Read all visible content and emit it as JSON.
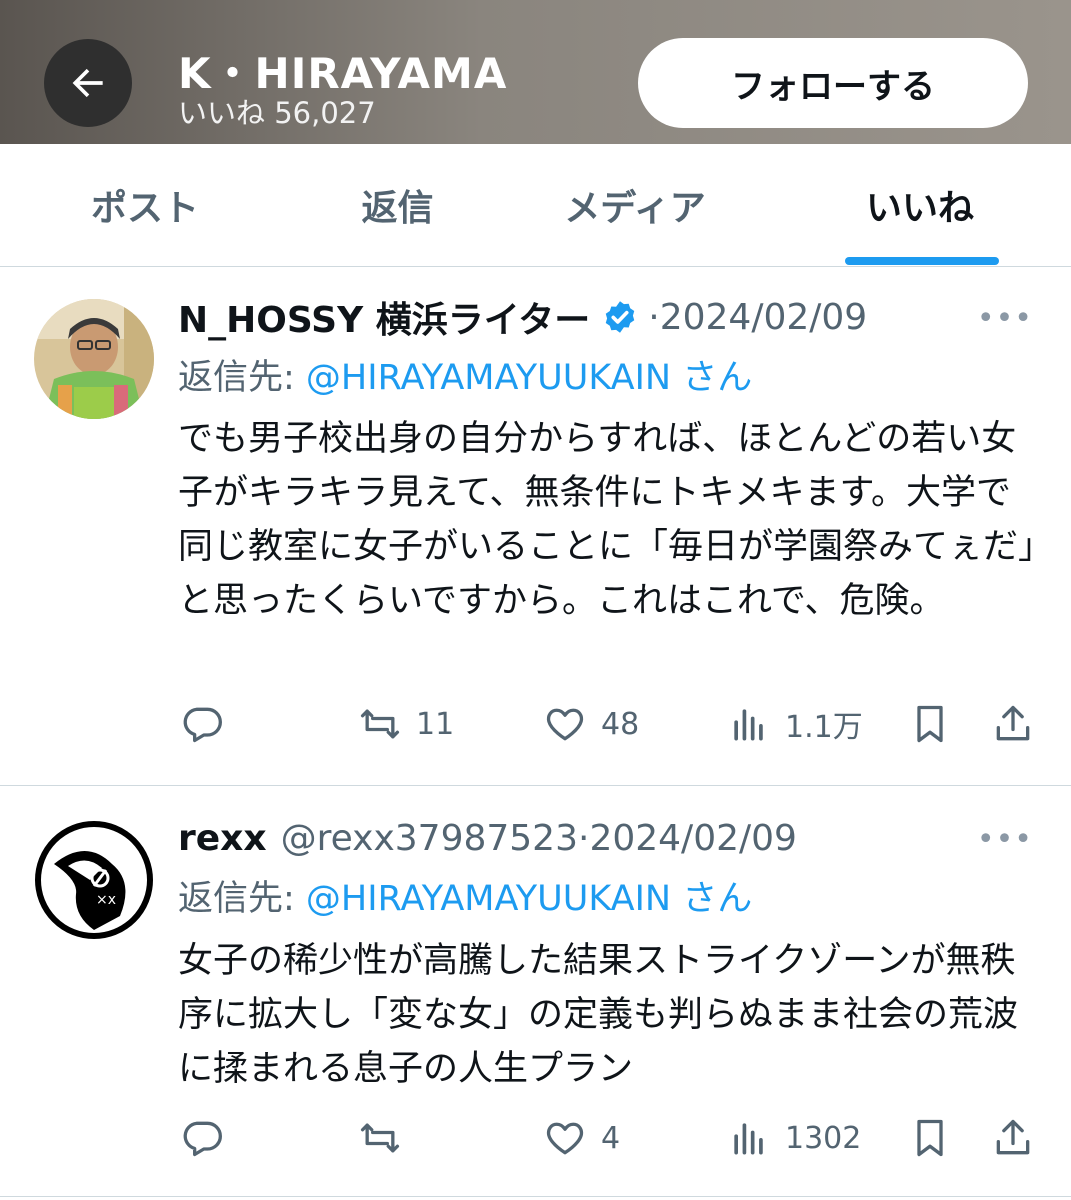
{
  "header": {
    "profile_name": "K・HIRAYAMA",
    "likes_label": "いいね 56,027",
    "follow_label": "フォローする"
  },
  "tabs": [
    {
      "label": "ポスト",
      "active": false
    },
    {
      "label": "返信",
      "active": false
    },
    {
      "label": "メディア",
      "active": false
    },
    {
      "label": "いいね",
      "active": true
    }
  ],
  "posts": [
    {
      "name": "N_HOSSY 横浜ライター",
      "verified": true,
      "handle": "",
      "date": "·2024/02/09",
      "more": "•••",
      "reply_prefix": "返信先: ",
      "reply_mention": "@HIRAYAMAYUUKAIN さん",
      "text": "でも男子校出身の自分からすれば、ほとんどの若い女子がキラキラ見えて、無条件にトキメキます。大学で同じ教室に女子がいることに「毎日が学園祭みてぇだ」と思ったくらいですから。これはこれで、危険。",
      "replies": "",
      "reposts": "11",
      "likes": "48",
      "views": "1.1万"
    },
    {
      "name": "rexx",
      "verified": false,
      "handle": "@rexx37987523",
      "date": "·2024/02/09",
      "more": "•••",
      "reply_prefix": "返信先: ",
      "reply_mention": "@HIRAYAMAYUUKAIN さん",
      "text": "女子の稀少性が高騰した結果ストライクゾーンが無秩序に拡大し「変な女」の定義も判らぬまま社会の荒波に揉まれる息子の人生プラン",
      "replies": "",
      "reposts": "",
      "likes": "4",
      "views": "1302"
    }
  ],
  "colors": {
    "accent": "#1d9bf0",
    "secondary_text": "#536471",
    "primary_text": "#0f1419"
  },
  "icons": [
    "back-arrow-icon",
    "verified-badge-icon",
    "reply-icon",
    "repost-icon",
    "like-icon",
    "views-icon",
    "bookmark-icon",
    "share-icon"
  ]
}
